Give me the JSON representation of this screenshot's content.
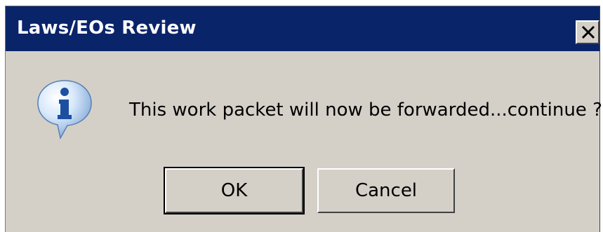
{
  "dialog": {
    "title": "Laws/EOs Review",
    "message": "This work packet will now be forwarded...continue ?",
    "icon": "info-icon",
    "buttons": {
      "ok_label": "OK",
      "cancel_label": "Cancel"
    }
  },
  "colors": {
    "titlebar": "#0a246a",
    "dialog_bg": "#d4d0c8",
    "title_text": "#ffffff"
  }
}
